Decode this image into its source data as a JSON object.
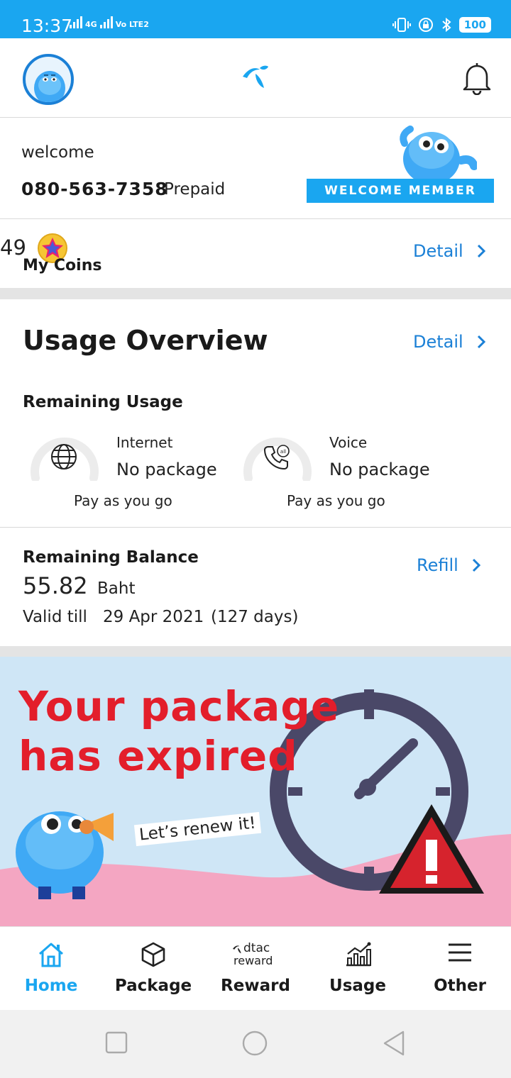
{
  "status_bar": {
    "time": "13:37",
    "network_tag_1": "4G",
    "network_tag_2": "Vo LTE2",
    "battery": "100"
  },
  "header": {
    "logo_icon": "dtac-logo-icon",
    "bell_icon": "bell-icon"
  },
  "welcome": {
    "greeting": "welcome",
    "phone": "080-563-7358",
    "plan": "Prepaid",
    "badge": "WELCOME MEMBER"
  },
  "coins": {
    "count": "49",
    "label": "My Coins",
    "detail_label": "Detail"
  },
  "usage": {
    "title": "Usage Overview",
    "detail_label": "Detail",
    "remaining_label": "Remaining Usage",
    "items": [
      {
        "kind": "Internet",
        "value": "No package",
        "sub": "Pay as you go",
        "icon": "globe-icon"
      },
      {
        "kind": "Voice",
        "value": "No package",
        "sub": "Pay as you go",
        "icon": "phone-all-icon"
      }
    ]
  },
  "balance": {
    "title": "Remaining Balance",
    "refill_label": "Refill",
    "amount": "55.82",
    "unit": "Baht",
    "valid_label": "Valid till",
    "valid_date": "29 Apr 2021",
    "valid_days": "(127 days)"
  },
  "banner": {
    "line1": "Your package",
    "line2": "has expired",
    "renew": "Let’s renew it!"
  },
  "nav": {
    "items": [
      {
        "label": "Home",
        "icon": "home-icon",
        "active": true
      },
      {
        "label": "Package",
        "icon": "box-icon",
        "active": false
      },
      {
        "label": "Reward",
        "icon": "dtac-reward-icon",
        "icon_text_1": "dtac",
        "icon_text_2": "reward",
        "active": false
      },
      {
        "label": "Usage",
        "icon": "chart-icon",
        "active": false
      },
      {
        "label": "Other",
        "icon": "menu-icon",
        "active": false
      }
    ]
  },
  "colors": {
    "brand_blue": "#1aa6f0",
    "link_blue": "#1b80d6",
    "alert_red": "#e31e2b"
  }
}
